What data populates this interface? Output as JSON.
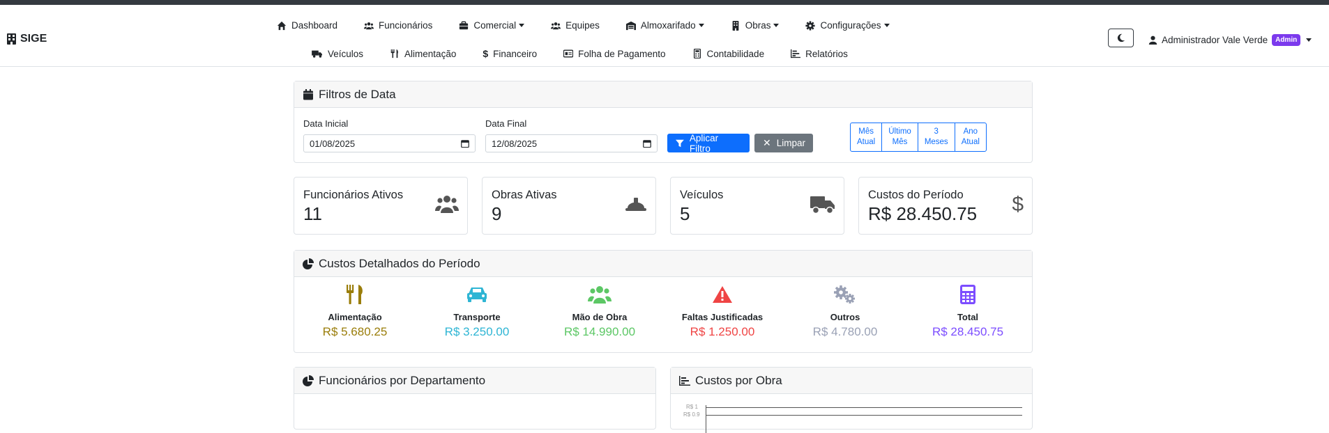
{
  "brand": "SIGE",
  "nav_row1": [
    "Dashboard",
    "Funcionários",
    "Comercial",
    "Equipes",
    "Almoxarifado",
    "Obras",
    "Configurações"
  ],
  "nav_row2": [
    "Veículos",
    "Alimentação",
    "Financeiro",
    "Folha de Pagamento",
    "Contabilidade",
    "Relatórios"
  ],
  "user": {
    "name": "Administrador Vale Verde",
    "badge": "Admin"
  },
  "filters": {
    "title": "Filtros de Data",
    "start_label": "Data Inicial",
    "start_value": "01/08/2025",
    "end_label": "Data Final",
    "end_value": "12/08/2025",
    "apply": "Aplicar Filtro",
    "clear": "Limpar",
    "quick": [
      [
        "Mês",
        "Atual"
      ],
      [
        "Último",
        "Mês"
      ],
      [
        "3",
        "Meses"
      ],
      [
        "Ano",
        "Atual"
      ]
    ]
  },
  "stats": [
    {
      "label": "Funcionários Ativos",
      "value": "11",
      "icon": "users-icon"
    },
    {
      "label": "Obras Ativas",
      "value": "9",
      "icon": "hard-hat-icon"
    },
    {
      "label": "Veículos",
      "value": "5",
      "icon": "truck-icon"
    },
    {
      "label": "Custos do Período",
      "value": "R$ 28.450.75",
      "icon": "dollar-icon"
    }
  ],
  "costs": {
    "title": "Custos Detalhados do Período",
    "items": [
      {
        "label": "Alimentação",
        "value": "R$ 5.680.25",
        "color": "#9a7d0a",
        "icon": "utensils-icon"
      },
      {
        "label": "Transporte",
        "value": "R$ 3.250.00",
        "color": "#2eb5d4",
        "icon": "car-icon"
      },
      {
        "label": "Mão de Obra",
        "value": "R$ 14.990.00",
        "color": "#5cc765",
        "icon": "users-icon"
      },
      {
        "label": "Faltas Justificadas",
        "value": "R$ 1.250.00",
        "color": "#ef4444",
        "icon": "warning-icon"
      },
      {
        "label": "Outros",
        "value": "R$ 4.780.00",
        "color": "#9aa1b5",
        "icon": "gears-icon"
      },
      {
        "label": "Total",
        "value": "R$ 28.450.75",
        "color": "#7c4dff",
        "icon": "calculator-icon"
      }
    ]
  },
  "panels": {
    "dept_title": "Funcionários por Departamento",
    "obra_title": "Custos por Obra",
    "obra_ticks": [
      "R$ 1",
      "R$ 0.9"
    ]
  }
}
